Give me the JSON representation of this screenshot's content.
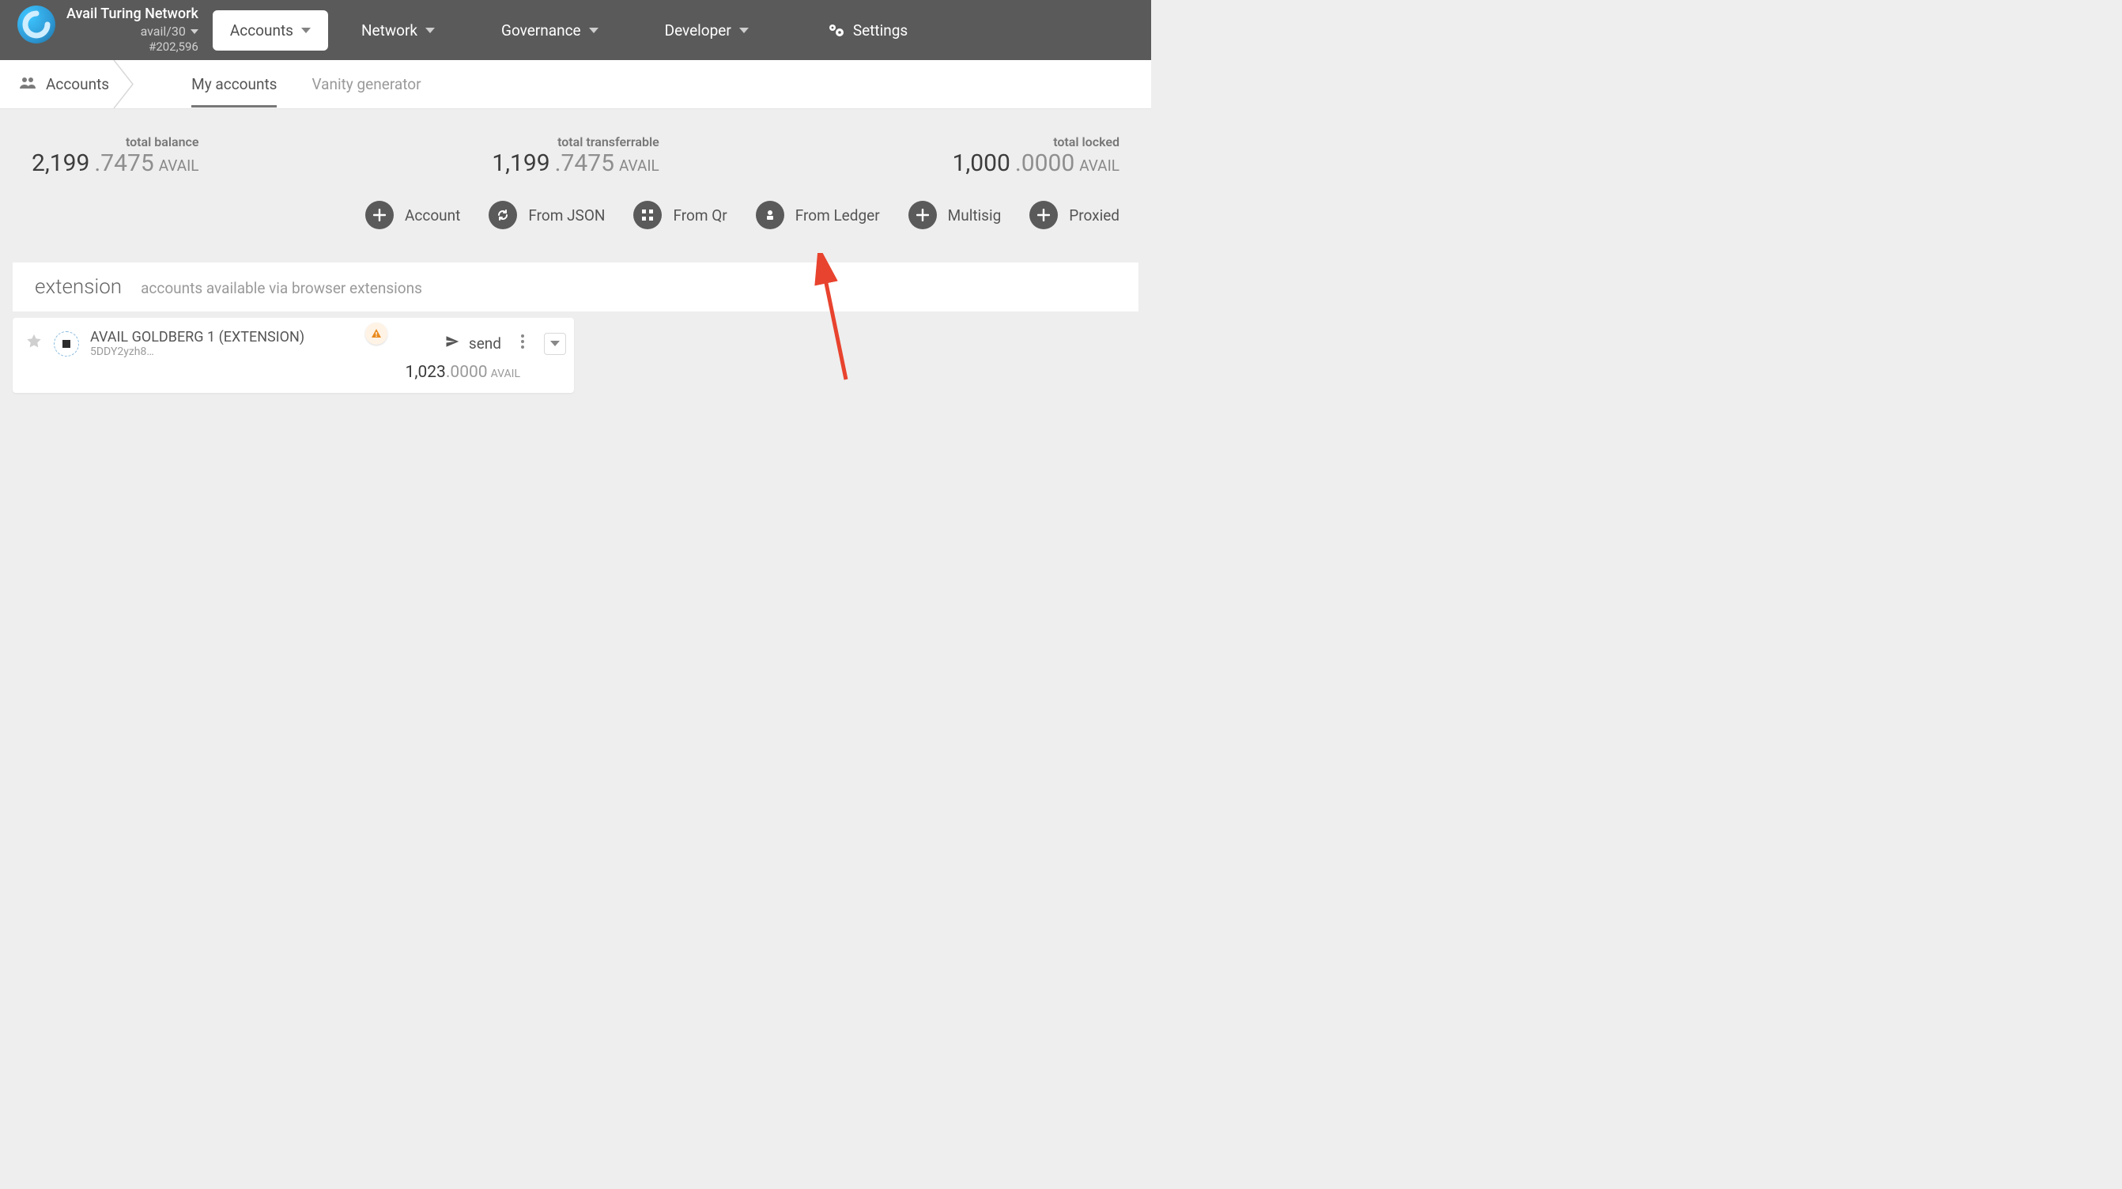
{
  "header": {
    "network_name": "Avail Turing Network",
    "address_format": "avail/30",
    "block_number": "#202,596",
    "nav": [
      {
        "label": "Accounts",
        "active": true
      },
      {
        "label": "Network",
        "active": false
      },
      {
        "label": "Governance",
        "active": false
      },
      {
        "label": "Developer",
        "active": false
      }
    ],
    "settings_label": "Settings"
  },
  "subnav": {
    "breadcrumb": "Accounts",
    "tabs": [
      {
        "label": "My accounts",
        "active": true
      },
      {
        "label": "Vanity generator",
        "active": false
      }
    ]
  },
  "stats": {
    "unit": "AVAIL",
    "total_balance": {
      "label": "total balance",
      "int": "2,199",
      "dec": ".7475"
    },
    "total_transferrable": {
      "label": "total transferrable",
      "int": "1,199",
      "dec": ".7475"
    },
    "total_locked": {
      "label": "total locked",
      "int": "1,000",
      "dec": ".0000"
    }
  },
  "actions": {
    "account": "Account",
    "from_json": "From JSON",
    "from_qr": "From Qr",
    "from_ledger": "From Ledger",
    "multisig": "Multisig",
    "proxied": "Proxied"
  },
  "section": {
    "title": "extension",
    "desc": "accounts available via browser extensions"
  },
  "account_row": {
    "name": "AVAIL GOLDBERG 1 (EXTENSION)",
    "address_short": "5DDY2yzh8…",
    "send_label": "send",
    "balance_int": "1,023",
    "balance_dec": ".0000",
    "unit": "AVAIL"
  }
}
